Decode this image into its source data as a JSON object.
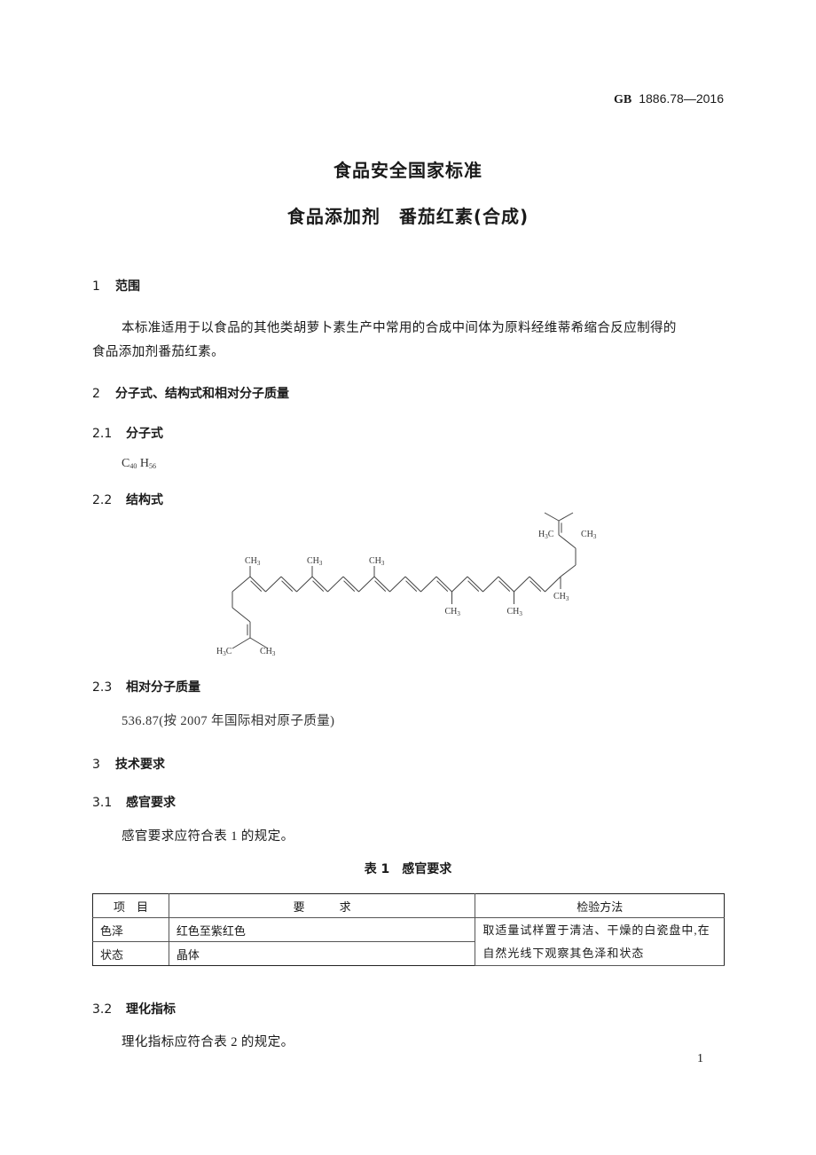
{
  "header": {
    "std_prefix": "GB",
    "std_number": "1886.78—2016"
  },
  "title": {
    "line1": "食品安全国家标准",
    "line2": "食品添加剂　番茄红素(合成)"
  },
  "sections": {
    "s1": {
      "num": "1",
      "title": "范围",
      "body_line1": "本标准适用于以食品的其他类胡萝卜素生产中常用的合成中间体为原料经维蒂希缩合反应制得的",
      "body_line2": "食品添加剂番茄红素。"
    },
    "s2": {
      "num": "2",
      "title": "分子式、结构式和相对分子质量"
    },
    "s2_1": {
      "num": "2.1",
      "title": "分子式",
      "formula": {
        "c": "C",
        "c_sub": "40",
        "h": "H",
        "h_sub": "56"
      }
    },
    "s2_2": {
      "num": "2.2",
      "title": "结构式",
      "labels": {
        "ch3": "CH3",
        "h3c": "H3C",
        "ch": "CH",
        "sub3": "3",
        "h": "H",
        "c": "C"
      }
    },
    "s2_3": {
      "num": "2.3",
      "title": "相对分子质量",
      "value": "536.87(按 2007 年国际相对原子质量)"
    },
    "s3": {
      "num": "3",
      "title": "技术要求"
    },
    "s3_1": {
      "num": "3.1",
      "title": "感官要求",
      "body": "感官要求应符合表 1 的规定。"
    },
    "table1": {
      "caption": "表 1　感官要求",
      "headers": [
        "项　目",
        "要　　　求",
        "检验方法"
      ],
      "rows": [
        {
          "item": "色泽",
          "requirement": "红色至紫红色"
        },
        {
          "item": "状态",
          "requirement": "晶体"
        }
      ],
      "method_line1": "取适量试样置于清洁、干燥的白瓷盘中,在",
      "method_line2": "自然光线下观察其色泽和状态"
    },
    "s3_2": {
      "num": "3.2",
      "title": "理化指标",
      "body": "理化指标应符合表 2 的规定。"
    }
  },
  "footer": {
    "page_number": "1"
  }
}
